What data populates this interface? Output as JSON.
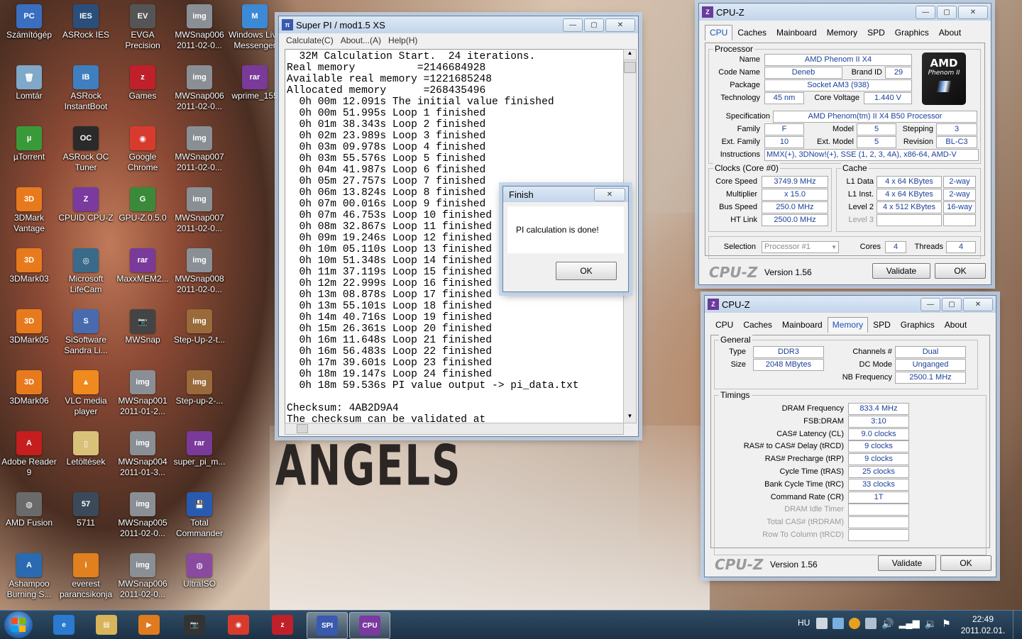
{
  "desktop": {
    "icons": [
      {
        "label": "Számítógép",
        "color": "#3a6fc0",
        "glyph": "PC"
      },
      {
        "label": "ASRock IES",
        "color": "#2a4f7a",
        "glyph": "IES"
      },
      {
        "label": "EVGA Precision",
        "color": "#555555",
        "glyph": "EV"
      },
      {
        "label": "MWSnap006 2011-02-0...",
        "color": "#8a8f95",
        "glyph": "img"
      },
      {
        "label": "Windows Live Messenger",
        "color": "#3c8ad6",
        "glyph": "M"
      },
      {
        "label": "Lomtár",
        "color": "#7fa8c9",
        "glyph": "🗑"
      },
      {
        "label": "ASRock InstantBoot",
        "color": "#3f7fc0",
        "glyph": "IB"
      },
      {
        "label": "Games",
        "color": "#c0202a",
        "glyph": "z"
      },
      {
        "label": "MWSnap006 2011-02-0...",
        "color": "#8a8f95",
        "glyph": "img"
      },
      {
        "label": "wprime_155",
        "color": "#7a3a9a",
        "glyph": "rar"
      },
      {
        "label": "µTorrent",
        "color": "#3a9a3a",
        "glyph": "µ"
      },
      {
        "label": "ASRock OC Tuner",
        "color": "#2a2a2a",
        "glyph": "OC"
      },
      {
        "label": "Google Chrome",
        "color": "#d83b2e",
        "glyph": "◉"
      },
      {
        "label": "MWSnap007 2011-02-0...",
        "color": "#8a8f95",
        "glyph": "img"
      },
      {
        "label": "3DMark Vantage",
        "color": "#e87a1e",
        "glyph": "3D"
      },
      {
        "label": "CPUID CPU-Z",
        "color": "#7a3aa0",
        "glyph": "Z"
      },
      {
        "label": "GPU-Z.0.5.0",
        "color": "#3a8a3a",
        "glyph": "G"
      },
      {
        "label": "MWSnap007 2011-02-0...",
        "color": "#8a8f95",
        "glyph": "img"
      },
      {
        "label": "3DMark03",
        "color": "#e87a1e",
        "glyph": "3D"
      },
      {
        "label": "Microsoft LifeCam",
        "color": "#3a6a8a",
        "glyph": "◎"
      },
      {
        "label": "MaxxMEM2...",
        "color": "#7a3a9a",
        "glyph": "rar"
      },
      {
        "label": "MWSnap008 2011-02-0...",
        "color": "#8a8f95",
        "glyph": "img"
      },
      {
        "label": "3DMark05",
        "color": "#e87a1e",
        "glyph": "3D"
      },
      {
        "label": "SiSoftware Sandra Li...",
        "color": "#4a6ab0",
        "glyph": "S"
      },
      {
        "label": "MWSnap",
        "color": "#444444",
        "glyph": "📷"
      },
      {
        "label": "Step-Up-2-t...",
        "color": "#9a6a3a",
        "glyph": "img"
      },
      {
        "label": "3DMark06",
        "color": "#e87a1e",
        "glyph": "3D"
      },
      {
        "label": "VLC media player",
        "color": "#f08a1e",
        "glyph": "▲"
      },
      {
        "label": "MWSnap001 2011-01-2...",
        "color": "#8a8f95",
        "glyph": "img"
      },
      {
        "label": "Step-up-2-...",
        "color": "#9a6a3a",
        "glyph": "img"
      },
      {
        "label": "Adobe Reader 9",
        "color": "#c41e1e",
        "glyph": "A"
      },
      {
        "label": "Letöltések",
        "color": "#d8c27a",
        "glyph": "▯"
      },
      {
        "label": "MWSnap004 2011-01-3...",
        "color": "#8a8f95",
        "glyph": "img"
      },
      {
        "label": "super_pi_m...",
        "color": "#7a3a9a",
        "glyph": "rar"
      },
      {
        "label": "AMD Fusion",
        "color": "#6a6a6a",
        "glyph": "◍"
      },
      {
        "label": "5711",
        "color": "#3a4a5a",
        "glyph": "57"
      },
      {
        "label": "MWSnap005 2011-02-0...",
        "color": "#8a8f95",
        "glyph": "img"
      },
      {
        "label": "Total Commander",
        "color": "#2a5ab0",
        "glyph": "💾"
      },
      {
        "label": "Ashampoo Burning S...",
        "color": "#2a6ab0",
        "glyph": "A"
      },
      {
        "label": "everest parancsikonja",
        "color": "#e0801e",
        "glyph": "i"
      },
      {
        "label": "MWSnap006 2011-02-0...",
        "color": "#8a8f95",
        "glyph": "img"
      },
      {
        "label": "UltraISO",
        "color": "#8a4aa0",
        "glyph": "◍"
      }
    ],
    "wallpaper_text": "ANGELS"
  },
  "superpi": {
    "title": "Super PI / mod1.5 XS",
    "menu": [
      "Calculate(C)",
      "About...(A)",
      "Help(H)"
    ],
    "lines": [
      "  32M Calculation Start.  24 iterations.",
      "Real memory          =2146684928",
      "Available real memory =1221685248",
      "Allocated memory      =268435496",
      "  0h 00m 12.091s The initial value finished",
      "  0h 00m 51.995s Loop 1 finished",
      "  0h 01m 38.343s Loop 2 finished",
      "  0h 02m 23.989s Loop 3 finished",
      "  0h 03m 09.978s Loop 4 finished",
      "  0h 03m 55.576s Loop 5 finished",
      "  0h 04m 41.987s Loop 6 finished",
      "  0h 05m 27.757s Loop 7 finished",
      "  0h 06m 13.824s Loop 8 finished",
      "  0h 07m 00.016s Loop 9 finished",
      "  0h 07m 46.753s Loop 10 finished",
      "  0h 08m 32.867s Loop 11 finished",
      "  0h 09m 19.246s Loop 12 finished",
      "  0h 10m 05.110s Loop 13 finished",
      "  0h 10m 51.348s Loop 14 finished",
      "  0h 11m 37.119s Loop 15 finished",
      "  0h 12m 22.999s Loop 16 finished",
      "  0h 13m 08.878s Loop 17 finished",
      "  0h 13m 55.101s Loop 18 finished",
      "  0h 14m 40.716s Loop 19 finished",
      "  0h 15m 26.361s Loop 20 finished",
      "  0h 16m 11.648s Loop 21 finished",
      "  0h 16m 56.483s Loop 22 finished",
      "  0h 17m 39.601s Loop 23 finished",
      "  0h 18m 19.147s Loop 24 finished",
      "  0h 18m 59.536s PI value output -> pi_data.txt",
      "",
      "Checksum: 4AB2D9A4",
      "The checksum can be validated at"
    ]
  },
  "finish": {
    "title": "Finish",
    "message": "PI calculation is done!",
    "ok": "OK"
  },
  "cpuz1": {
    "title": "CPU-Z",
    "tabs": [
      "CPU",
      "Caches",
      "Mainboard",
      "Memory",
      "SPD",
      "Graphics",
      "About"
    ],
    "active_tab": "CPU",
    "processor_group": "Processor",
    "name_label": "Name",
    "name": "AMD Phenom II X4",
    "codename_label": "Code Name",
    "codename": "Deneb",
    "brandid_label": "Brand ID",
    "brandid": "29",
    "package_label": "Package",
    "package": "Socket AM3 (938)",
    "tech_label": "Technology",
    "tech": "45 nm",
    "voltage_label": "Core Voltage",
    "voltage": "1.440 V",
    "spec_label": "Specification",
    "spec": "AMD Phenom(tm) II X4 B50 Processor",
    "family_label": "Family",
    "family": "F",
    "model_label": "Model",
    "model": "5",
    "stepping_label": "Stepping",
    "stepping": "3",
    "extfamily_label": "Ext. Family",
    "extfamily": "10",
    "extmodel_label": "Ext. Model",
    "extmodel": "5",
    "revision_label": "Revision",
    "revision": "BL-C3",
    "instr_label": "Instructions",
    "instr": "MMX(+), 3DNow!(+), SSE (1, 2, 3, 4A), x86-64, AMD-V",
    "logo_top": "AMD",
    "logo_bottom": "Phenom II",
    "clocks_group": "Clocks (Core #0)",
    "corespeed_label": "Core Speed",
    "corespeed": "3749.9 MHz",
    "mult_label": "Multiplier",
    "mult": "x 15.0",
    "bus_label": "Bus Speed",
    "bus": "250.0 MHz",
    "ht_label": "HT Link",
    "ht": "2500.0 MHz",
    "cache_group": "Cache",
    "l1d_label": "L1 Data",
    "l1d": "4 x 64 KBytes",
    "l1d_way": "2-way",
    "l1i_label": "L1 Inst.",
    "l1i": "4 x 64 KBytes",
    "l1i_way": "2-way",
    "l2_label": "Level 2",
    "l2": "4 x 512 KBytes",
    "l2_way": "16-way",
    "l3_label": "Level 3",
    "selection_label": "Selection",
    "selection": "Processor #1",
    "cores_label": "Cores",
    "cores": "4",
    "threads_label": "Threads",
    "threads": "4",
    "brand": "CPU-Z",
    "version": "Version 1.56",
    "validate": "Validate",
    "ok": "OK"
  },
  "cpuz2": {
    "title": "CPU-Z",
    "tabs": [
      "CPU",
      "Caches",
      "Mainboard",
      "Memory",
      "SPD",
      "Graphics",
      "About"
    ],
    "active_tab": "Memory",
    "general_group": "General",
    "type_label": "Type",
    "type": "DDR3",
    "size_label": "Size",
    "size": "2048 MBytes",
    "channels_label": "Channels #",
    "channels": "Dual",
    "dcmode_label": "DC Mode",
    "dcmode": "Unganged",
    "nbfreq_label": "NB Frequency",
    "nbfreq": "2500.1 MHz",
    "timings_group": "Timings",
    "timings": [
      {
        "label": "DRAM Frequency",
        "value": "833.4 MHz",
        "dim": false
      },
      {
        "label": "FSB:DRAM",
        "value": "3:10",
        "dim": false
      },
      {
        "label": "CAS# Latency (CL)",
        "value": "9.0 clocks",
        "dim": false
      },
      {
        "label": "RAS# to CAS# Delay (tRCD)",
        "value": "9 clocks",
        "dim": false
      },
      {
        "label": "RAS# Precharge (tRP)",
        "value": "9 clocks",
        "dim": false
      },
      {
        "label": "Cycle Time (tRAS)",
        "value": "25 clocks",
        "dim": false
      },
      {
        "label": "Bank Cycle Time (tRC)",
        "value": "33 clocks",
        "dim": false
      },
      {
        "label": "Command Rate (CR)",
        "value": "1T",
        "dim": false
      },
      {
        "label": "DRAM Idle Timer",
        "value": "",
        "dim": true
      },
      {
        "label": "Total CAS# (tRDRAM)",
        "value": "",
        "dim": true
      },
      {
        "label": "Row To Column (tRCD)",
        "value": "",
        "dim": true
      }
    ],
    "brand": "CPU-Z",
    "version": "Version 1.56",
    "validate": "Validate",
    "ok": "OK"
  },
  "taskbar": {
    "apps": [
      {
        "name": "internet-explorer",
        "color": "#2a7ad0",
        "glyph": "e"
      },
      {
        "name": "explorer",
        "color": "#d8b45a",
        "glyph": "▤"
      },
      {
        "name": "media-player",
        "color": "#e07a1e",
        "glyph": "▶"
      },
      {
        "name": "mwsnap",
        "color": "#333333",
        "glyph": "📷"
      },
      {
        "name": "chrome",
        "color": "#d83b2e",
        "glyph": "◉"
      },
      {
        "name": "zynga",
        "color": "#c0202a",
        "glyph": "z"
      },
      {
        "name": "super-pi",
        "color": "#3a5ab0",
        "glyph": "SPI"
      },
      {
        "name": "cpu-z",
        "color": "#7a3aa0",
        "glyph": "CPU"
      }
    ],
    "lang": "HU",
    "time": "22:49",
    "date": "2011.02.01."
  }
}
